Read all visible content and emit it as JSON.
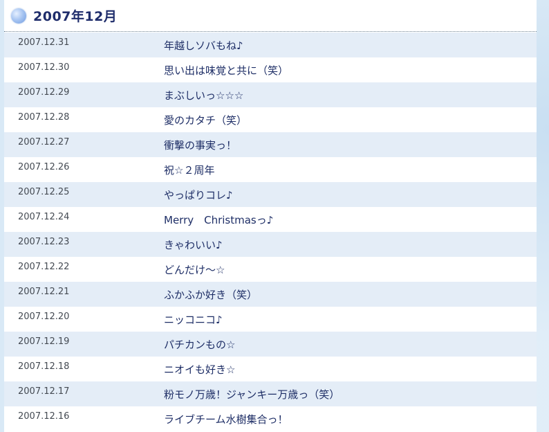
{
  "header": {
    "title": "2007年12月"
  },
  "entries": [
    {
      "date": "2007.12.31",
      "title": "年越しソバもね♪"
    },
    {
      "date": "2007.12.30",
      "title": "思い出は味覚と共に（笑）"
    },
    {
      "date": "2007.12.29",
      "title": "まぶしいっ☆☆☆"
    },
    {
      "date": "2007.12.28",
      "title": "愛のカタチ（笑）"
    },
    {
      "date": "2007.12.27",
      "title": "衝撃の事実っ！"
    },
    {
      "date": "2007.12.26",
      "title": "祝☆２周年"
    },
    {
      "date": "2007.12.25",
      "title": "やっぱりコレ♪"
    },
    {
      "date": "2007.12.24",
      "title": "Merry　Christmasっ♪"
    },
    {
      "date": "2007.12.23",
      "title": "きゃわいい♪"
    },
    {
      "date": "2007.12.22",
      "title": "どんだけ〜☆"
    },
    {
      "date": "2007.12.21",
      "title": "ふかふか好き（笑）"
    },
    {
      "date": "2007.12.20",
      "title": "ニッコニコ♪"
    },
    {
      "date": "2007.12.19",
      "title": "パチカンもの☆"
    },
    {
      "date": "2007.12.18",
      "title": "ニオイも好き☆"
    },
    {
      "date": "2007.12.17",
      "title": "粉モノ万歳！ジャンキー万歳っ（笑）"
    },
    {
      "date": "2007.12.16",
      "title": "ライブチーム水樹集合っ！"
    }
  ]
}
